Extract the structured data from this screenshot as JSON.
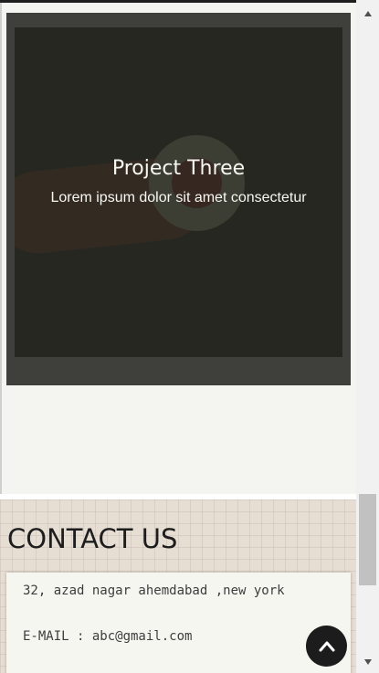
{
  "project": {
    "title": "Project Three",
    "description": "Lorem ipsum dolor sit amet consectetur"
  },
  "contact": {
    "heading": "CONTACT US",
    "address": "32, azad nagar ahemdabad ,new york",
    "email": "E-MAIL : abc@gmail.com"
  },
  "icons": {
    "back_to_top": "chevron-up-icon",
    "scroll_up": "triangle-up-icon",
    "scroll_down": "triangle-down-icon"
  },
  "colors": {
    "page_background": "#f4f4f0",
    "overlay": "#2c2c27",
    "contact_background": "#e6ddd3",
    "back_to_top": "#1c1c1c"
  },
  "scroll": {
    "position_fraction": 0.8
  }
}
